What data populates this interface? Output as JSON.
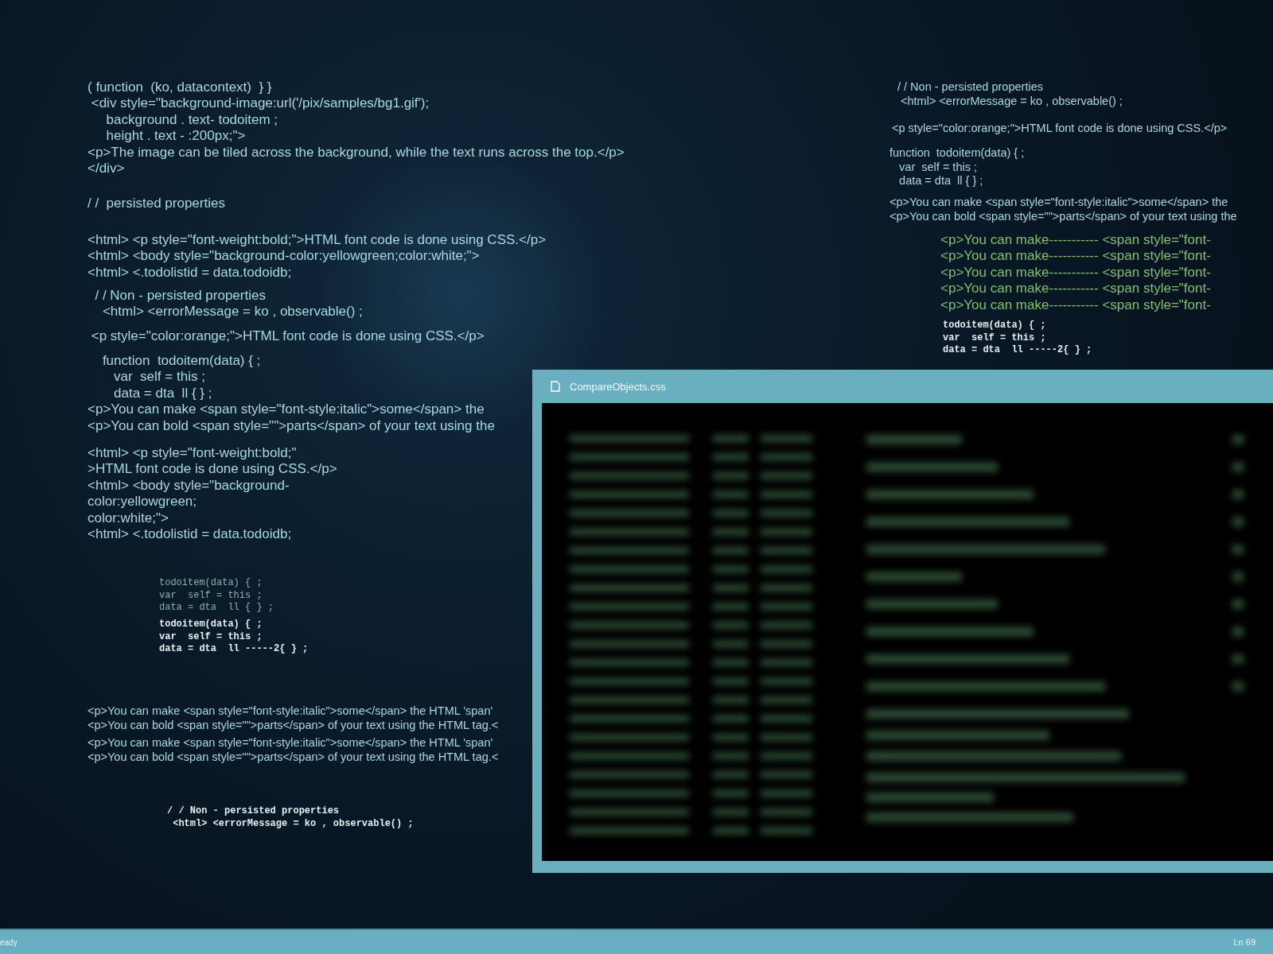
{
  "code_blocks": [
    {
      "kind": "sans",
      "lines": [
        "( function  (ko, datacontext)  } }",
        " <div style=\"background-image:url('/pix/samples/bg1.gif');",
        "     background . text- todoitem ;",
        "     height . text - :200px;\">",
        "<p>The image can be tiled across the background, while the text runs across the top.</p>",
        "</div>"
      ]
    },
    {
      "kind": "sans",
      "lines": [
        "/ /  persisted properties"
      ]
    },
    {
      "kind": "sans",
      "lines": [
        "<html> <p style=\"font-weight:bold;\">HTML font code is done using CSS.</p>",
        "<html> <body style=\"background-color:yellowgreen;color:white;\">",
        "<html> <.todolistid = data.todoidb;"
      ]
    },
    {
      "kind": "sans",
      "lines": [
        "  / / Non - persisted properties",
        "    <html> <errorMessage = ko , observable() ;"
      ]
    },
    {
      "kind": "sans",
      "lines": [
        " <p style=\"color:orange;\">HTML font code is done using CSS.</p>"
      ]
    },
    {
      "kind": "sans",
      "lines": [
        "    function  todoitem(data) { ;",
        "       var  self = this ;",
        "       data = dta  ll { } ;",
        "<p>You can make <span style=\"font-style:italic\">some</span> the",
        "<p>You can bold <span style=\"\">parts</span> of your text using the"
      ]
    },
    {
      "kind": "sans",
      "lines": [
        "<html> <p style=\"font-weight:bold;\"",
        ">HTML font code is done using CSS.</p>",
        "<html> <body style=\"background-",
        "color:yellowgreen;",
        "color:white;\">",
        "<html> <.todolistid = data.todoidb;"
      ]
    },
    {
      "kind": "mono-dim",
      "lines": [
        "todoitem(data) { ;",
        "var  self = this ;",
        "data = dta  ll { } ;"
      ]
    },
    {
      "kind": "mono-bright",
      "lines": [
        "todoitem(data) { ;",
        "var  self = this ;",
        "data = dta  ll -----2{ } ;"
      ]
    },
    {
      "kind": "sans-small",
      "lines": [
        "<p>You can make <span style=\"font-style:italic\">some</span> the HTML 'span'",
        "<p>You can bold <span style=\"\">parts</span> of your text using the HTML tag.<"
      ]
    },
    {
      "kind": "sans-small",
      "lines": [
        "<p>You can make <span style=\"font-style:italic\">some</span> the HTML 'span'",
        "<p>You can bold <span style=\"\">parts</span> of your text using the HTML tag.<"
      ]
    },
    {
      "kind": "mono-bright",
      "lines": [
        "/ / Non - persisted properties",
        " <html> <errorMessage = ko , observable() ;"
      ]
    },
    {
      "kind": "sans-small",
      "lines": [
        "/ / Non - persisted properties",
        " <html> <errorMessage = ko , observable() ;"
      ]
    },
    {
      "kind": "sans-small",
      "lines": [
        "<p style=\"color:orange;\">HTML font code is done using CSS.</p>"
      ]
    },
    {
      "kind": "sans-small",
      "lines": [
        "function  todoitem(data) { ;",
        "   var  self = this ;",
        "   data = dta  ll { } ;"
      ]
    },
    {
      "kind": "sans-small",
      "lines": [
        "<p>You can make <span style=\"font-style:italic\">some</span> the",
        "<p>You can bold <span style=\"\">parts</span> of your text using the"
      ]
    },
    {
      "kind": "sans-green",
      "lines": [
        "<p>You can make----------- <span style=\"font-",
        "<p>You can make----------- <span style=\"font-",
        "<p>You can make----------- <span style=\"font-",
        "<p>You can make----------- <span style=\"font-",
        "<p>You can make----------- <span style=\"font-"
      ]
    },
    {
      "kind": "mono-bright",
      "lines": [
        "todoitem(data) { ;",
        "var  self = this ;",
        "data = dta  ll -----2{ } ;"
      ]
    }
  ],
  "editor_window": {
    "title": "CompareObjects.css"
  },
  "status_bar": {
    "left": "eady",
    "right": "Ln 69"
  }
}
